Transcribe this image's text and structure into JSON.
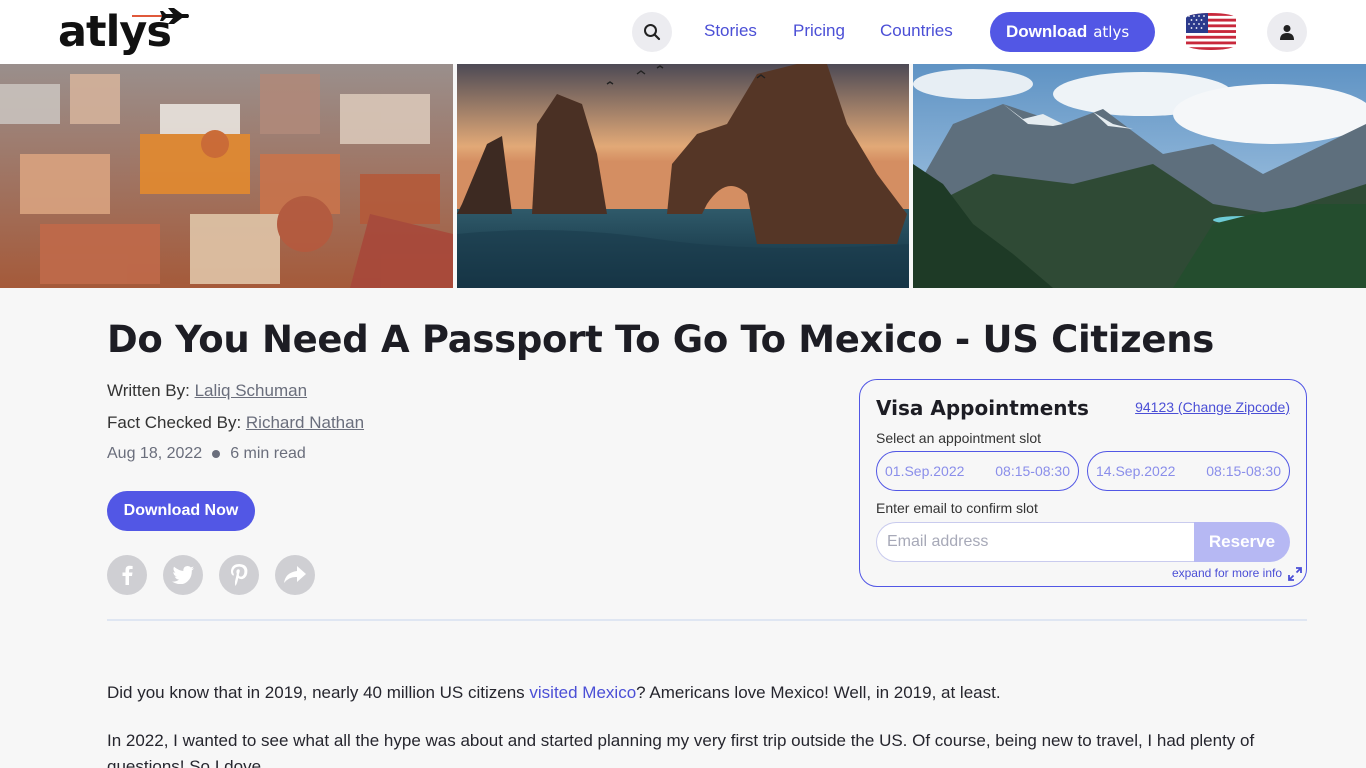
{
  "header": {
    "logo_text": "atlys",
    "nav": [
      "Stories",
      "Pricing",
      "Countries"
    ],
    "download_label": "Download",
    "download_logo": "atlys",
    "icons": {
      "search": "search-icon",
      "flag": "us-flag-icon",
      "account": "user-icon"
    }
  },
  "hero": {
    "images": [
      "guanajuato-city-aerial",
      "cabo-san-lucas-arch-sunset",
      "mountain-valley-forest"
    ]
  },
  "article": {
    "title": "Do You Need A Passport To Go To Mexico - US Citizens",
    "written_by_label": "Written By:",
    "author": "Laliq Schuman",
    "fact_checked_label": "Fact Checked By:",
    "fact_checker": "Richard Nathan",
    "date": "Aug 18, 2022",
    "read_time": "6 min read",
    "download_now": "Download Now",
    "share_icons": [
      "facebook-icon",
      "twitter-icon",
      "pinterest-icon",
      "share-icon"
    ],
    "para1_before": "Did you know that in 2019, nearly 40 million US citizens ",
    "para1_link": "visited Mexico",
    "para1_after": "? Americans love Mexico! Well, in 2019, at least.",
    "para2": "In 2022, I wanted to see what all the hype was about and started planning my very first trip outside the US. Of course, being new to travel, I had plenty of questions! So I dove..."
  },
  "visa": {
    "title": "Visa Appointments",
    "zipcode": "94123 (Change Zipcode)",
    "slot_label": "Select an appointment slot",
    "slots": [
      {
        "date": "01.Sep.2022",
        "time": "08:15-08:30"
      },
      {
        "date": "14.Sep.2022",
        "time": "08:15-08:30"
      }
    ],
    "email_label": "Enter email to confirm slot",
    "email_placeholder": "Email address",
    "reserve": "Reserve",
    "expand": "expand for more info"
  },
  "colors": {
    "accent": "#5257e5",
    "link": "#4b4fd6",
    "background": "#f7f7f7"
  }
}
